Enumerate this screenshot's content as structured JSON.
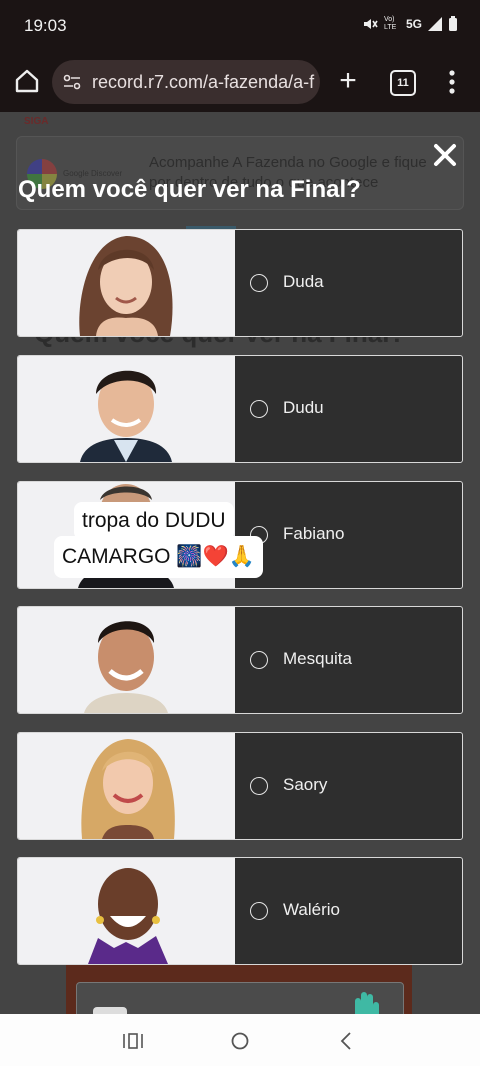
{
  "status_bar": {
    "time": "19:03",
    "volte": "Vo) LTE",
    "network": "5G"
  },
  "browser": {
    "url": "record.r7.com/a-fazenda/a-f",
    "tab_count": "11"
  },
  "background_page": {
    "siga_label": "SIGA",
    "google_card_text": "Acompanhe A Fazenda no Google e fique por dentro de tudo o que acontece",
    "google_card_brand": "Google Discover",
    "title_behind": "Quem você quer ver na Final?"
  },
  "quiz": {
    "title": "Quem você quer ver na Final?",
    "options": [
      {
        "label": "Duda"
      },
      {
        "label": "Dudu"
      },
      {
        "label": "Fabiano"
      },
      {
        "label": "Mesquita"
      },
      {
        "label": "Saory"
      },
      {
        "label": "Walério"
      }
    ]
  },
  "sticker": {
    "line1": "tropa do DUDU",
    "line2": "CAMARGO 🎆❤️🙏"
  },
  "colors": {
    "browser_bar": "#1b1414",
    "url_pill": "#3a2e2e",
    "overlay_card": "#2e2e2e",
    "photo_bg": "#f1f1f3"
  }
}
